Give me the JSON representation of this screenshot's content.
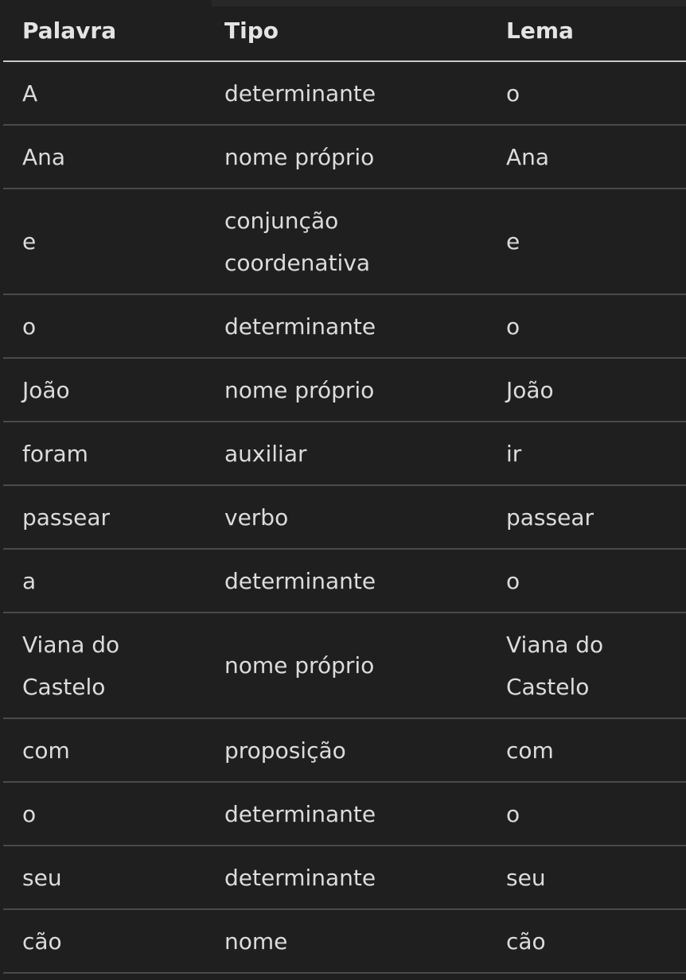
{
  "table": {
    "headers": [
      "Palavra",
      "Tipo",
      "Lema"
    ],
    "rows": [
      [
        "A",
        "determinante",
        "o"
      ],
      [
        "Ana",
        "nome próprio",
        "Ana"
      ],
      [
        "e",
        "conjunção coordenativa",
        "e"
      ],
      [
        "o",
        "determinante",
        "o"
      ],
      [
        "João",
        "nome próprio",
        "João"
      ],
      [
        "foram",
        "auxiliar",
        "ir"
      ],
      [
        "passear",
        "verbo",
        "passear"
      ],
      [
        "a",
        "determinante",
        "o"
      ],
      [
        "Viana do Castelo",
        "nome próprio",
        "Viana do Castelo"
      ],
      [
        "com",
        "proposição",
        "com"
      ],
      [
        "o",
        "determinante",
        "o"
      ],
      [
        "seu",
        "determinante",
        "seu"
      ],
      [
        "cão",
        "nome",
        "cão"
      ]
    ]
  }
}
